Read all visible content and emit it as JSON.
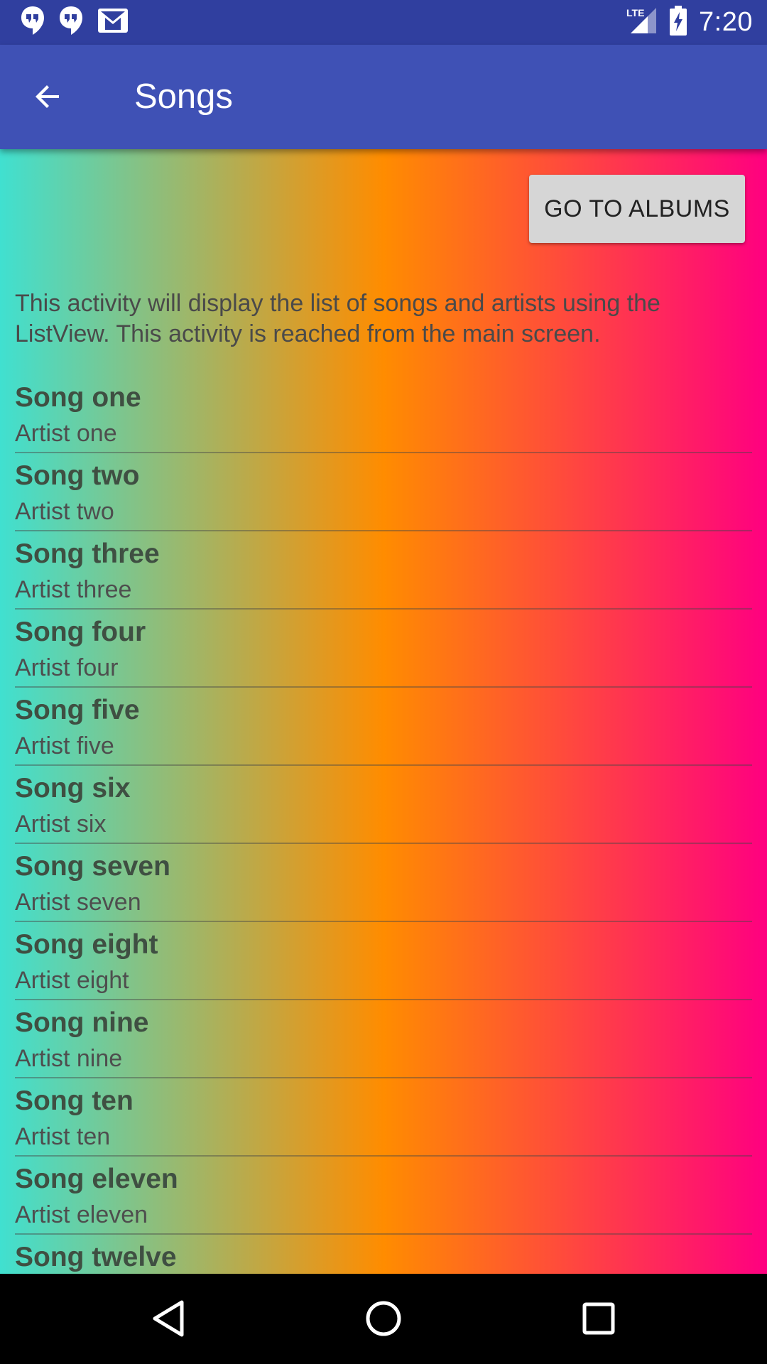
{
  "status_bar": {
    "time": "7:20",
    "network": "LTE",
    "icons": [
      "hangouts-icon",
      "hangouts-icon",
      "gmail-icon",
      "lte-signal-icon",
      "battery-charging-icon"
    ]
  },
  "app_bar": {
    "title": "Songs",
    "back_icon": "arrow-back-icon",
    "color": "#3F51B5"
  },
  "content": {
    "goto_button_label": "GO TO ALBUMS",
    "description": "This activity will display the list of songs and artists using the ListView. This activity is reached from the main screen.",
    "gradient": [
      "#40E0D0",
      "#FF8C00",
      "#FF0080"
    ],
    "songs": [
      {
        "title": "Song one",
        "artist": "Artist one"
      },
      {
        "title": "Song two",
        "artist": "Artist two"
      },
      {
        "title": "Song three",
        "artist": "Artist three"
      },
      {
        "title": "Song four",
        "artist": "Artist four"
      },
      {
        "title": "Song five",
        "artist": "Artist five"
      },
      {
        "title": "Song six",
        "artist": "Artist six"
      },
      {
        "title": "Song seven",
        "artist": "Artist seven"
      },
      {
        "title": "Song eight",
        "artist": "Artist eight"
      },
      {
        "title": "Song nine",
        "artist": "Artist nine"
      },
      {
        "title": "Song ten",
        "artist": "Artist ten"
      },
      {
        "title": "Song eleven",
        "artist": "Artist eleven"
      },
      {
        "title": "Song twelve",
        "artist": ""
      }
    ]
  },
  "nav_bar": {
    "icons": [
      "back-triangle-icon",
      "home-circle-icon",
      "recents-square-icon"
    ]
  }
}
